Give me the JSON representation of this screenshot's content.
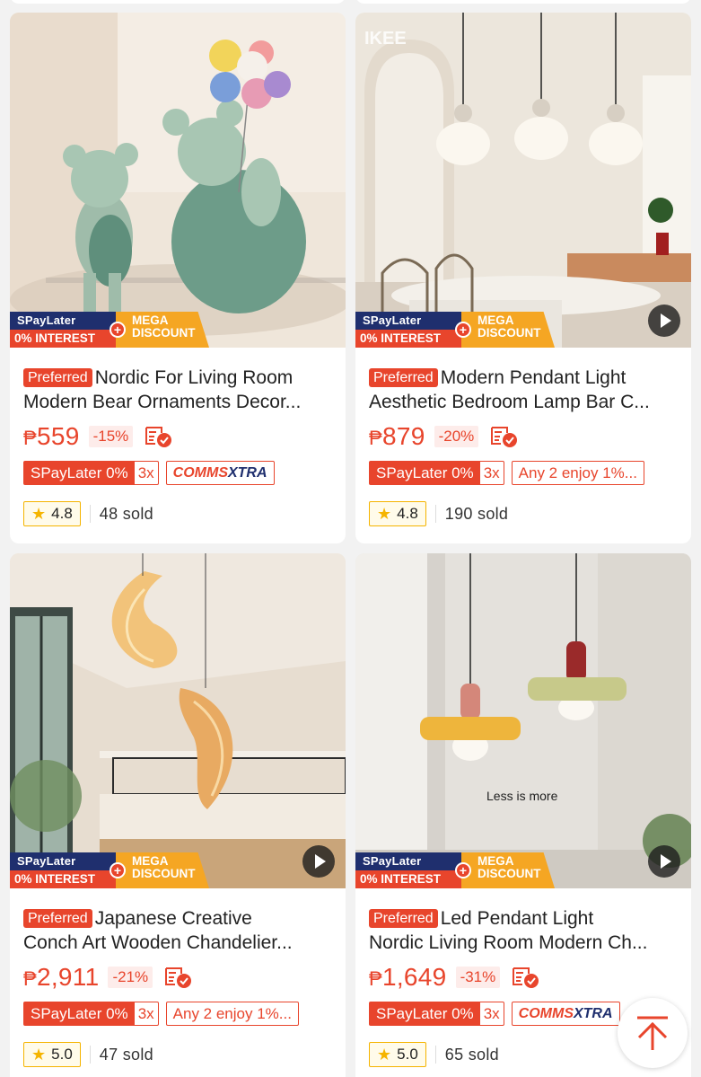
{
  "products": [
    {
      "pref": "Preferred",
      "title1": "Nordic For Living Room",
      "title2": "Modern Bear Ornaments Decor...",
      "currency": "₱",
      "price": "559",
      "discount": "-15%",
      "spl_tag": "SPayLater 0%",
      "spl_x": "3x",
      "tag2_type": "comms",
      "tag2": "",
      "rating": "4.8",
      "sold": "48 sold",
      "has_video": false,
      "image_watermark": "",
      "image_caption": ""
    },
    {
      "pref": "Preferred",
      "title1": "Modern Pendant Light",
      "title2": "Aesthetic Bedroom Lamp Bar C...",
      "currency": "₱",
      "price": "879",
      "discount": "-20%",
      "spl_tag": "SPayLater 0%",
      "spl_x": "3x",
      "tag2_type": "text",
      "tag2": "Any 2 enjoy 1%...",
      "rating": "4.8",
      "sold": "190 sold",
      "has_video": true,
      "image_watermark": "IKEE",
      "image_caption": ""
    },
    {
      "pref": "Preferred",
      "title1": "Japanese Creative",
      "title2": "Conch Art Wooden Chandelier...",
      "currency": "₱",
      "price": "2,911",
      "discount": "-21%",
      "spl_tag": "SPayLater 0%",
      "spl_x": "3x",
      "tag2_type": "text",
      "tag2": "Any 2 enjoy 1%...",
      "rating": "5.0",
      "sold": "47 sold",
      "has_video": true,
      "image_watermark": "",
      "image_caption": ""
    },
    {
      "pref": "Preferred",
      "title1": "Led Pendant Light",
      "title2": "Nordic Living Room Modern Ch...",
      "currency": "₱",
      "price": "1,649",
      "discount": "-31%",
      "spl_tag": "SPayLater 0%",
      "spl_x": "3x",
      "tag2_type": "comms",
      "tag2": "",
      "rating": "5.0",
      "sold": "65 sold",
      "has_video": true,
      "image_watermark": "",
      "image_caption": "Less is more"
    }
  ],
  "promo_badge": {
    "spaylater": "SPayLater",
    "interest": "0% INTEREST",
    "plus": "+",
    "mega1": "MEGA",
    "mega2": "DISCOUNT"
  },
  "comms_tag": {
    "part1": "COMMS",
    "part2": "XTRA"
  },
  "colors": {
    "accent": "#e8452c",
    "navy": "#1f2f6e",
    "gold": "#f5a623",
    "star": "#f5b400"
  },
  "icons": {
    "scroll_top": "arrow-up-to-top-icon",
    "shipping": "free-shipping-check-icon",
    "video": "play-icon",
    "rating": "star-icon"
  }
}
